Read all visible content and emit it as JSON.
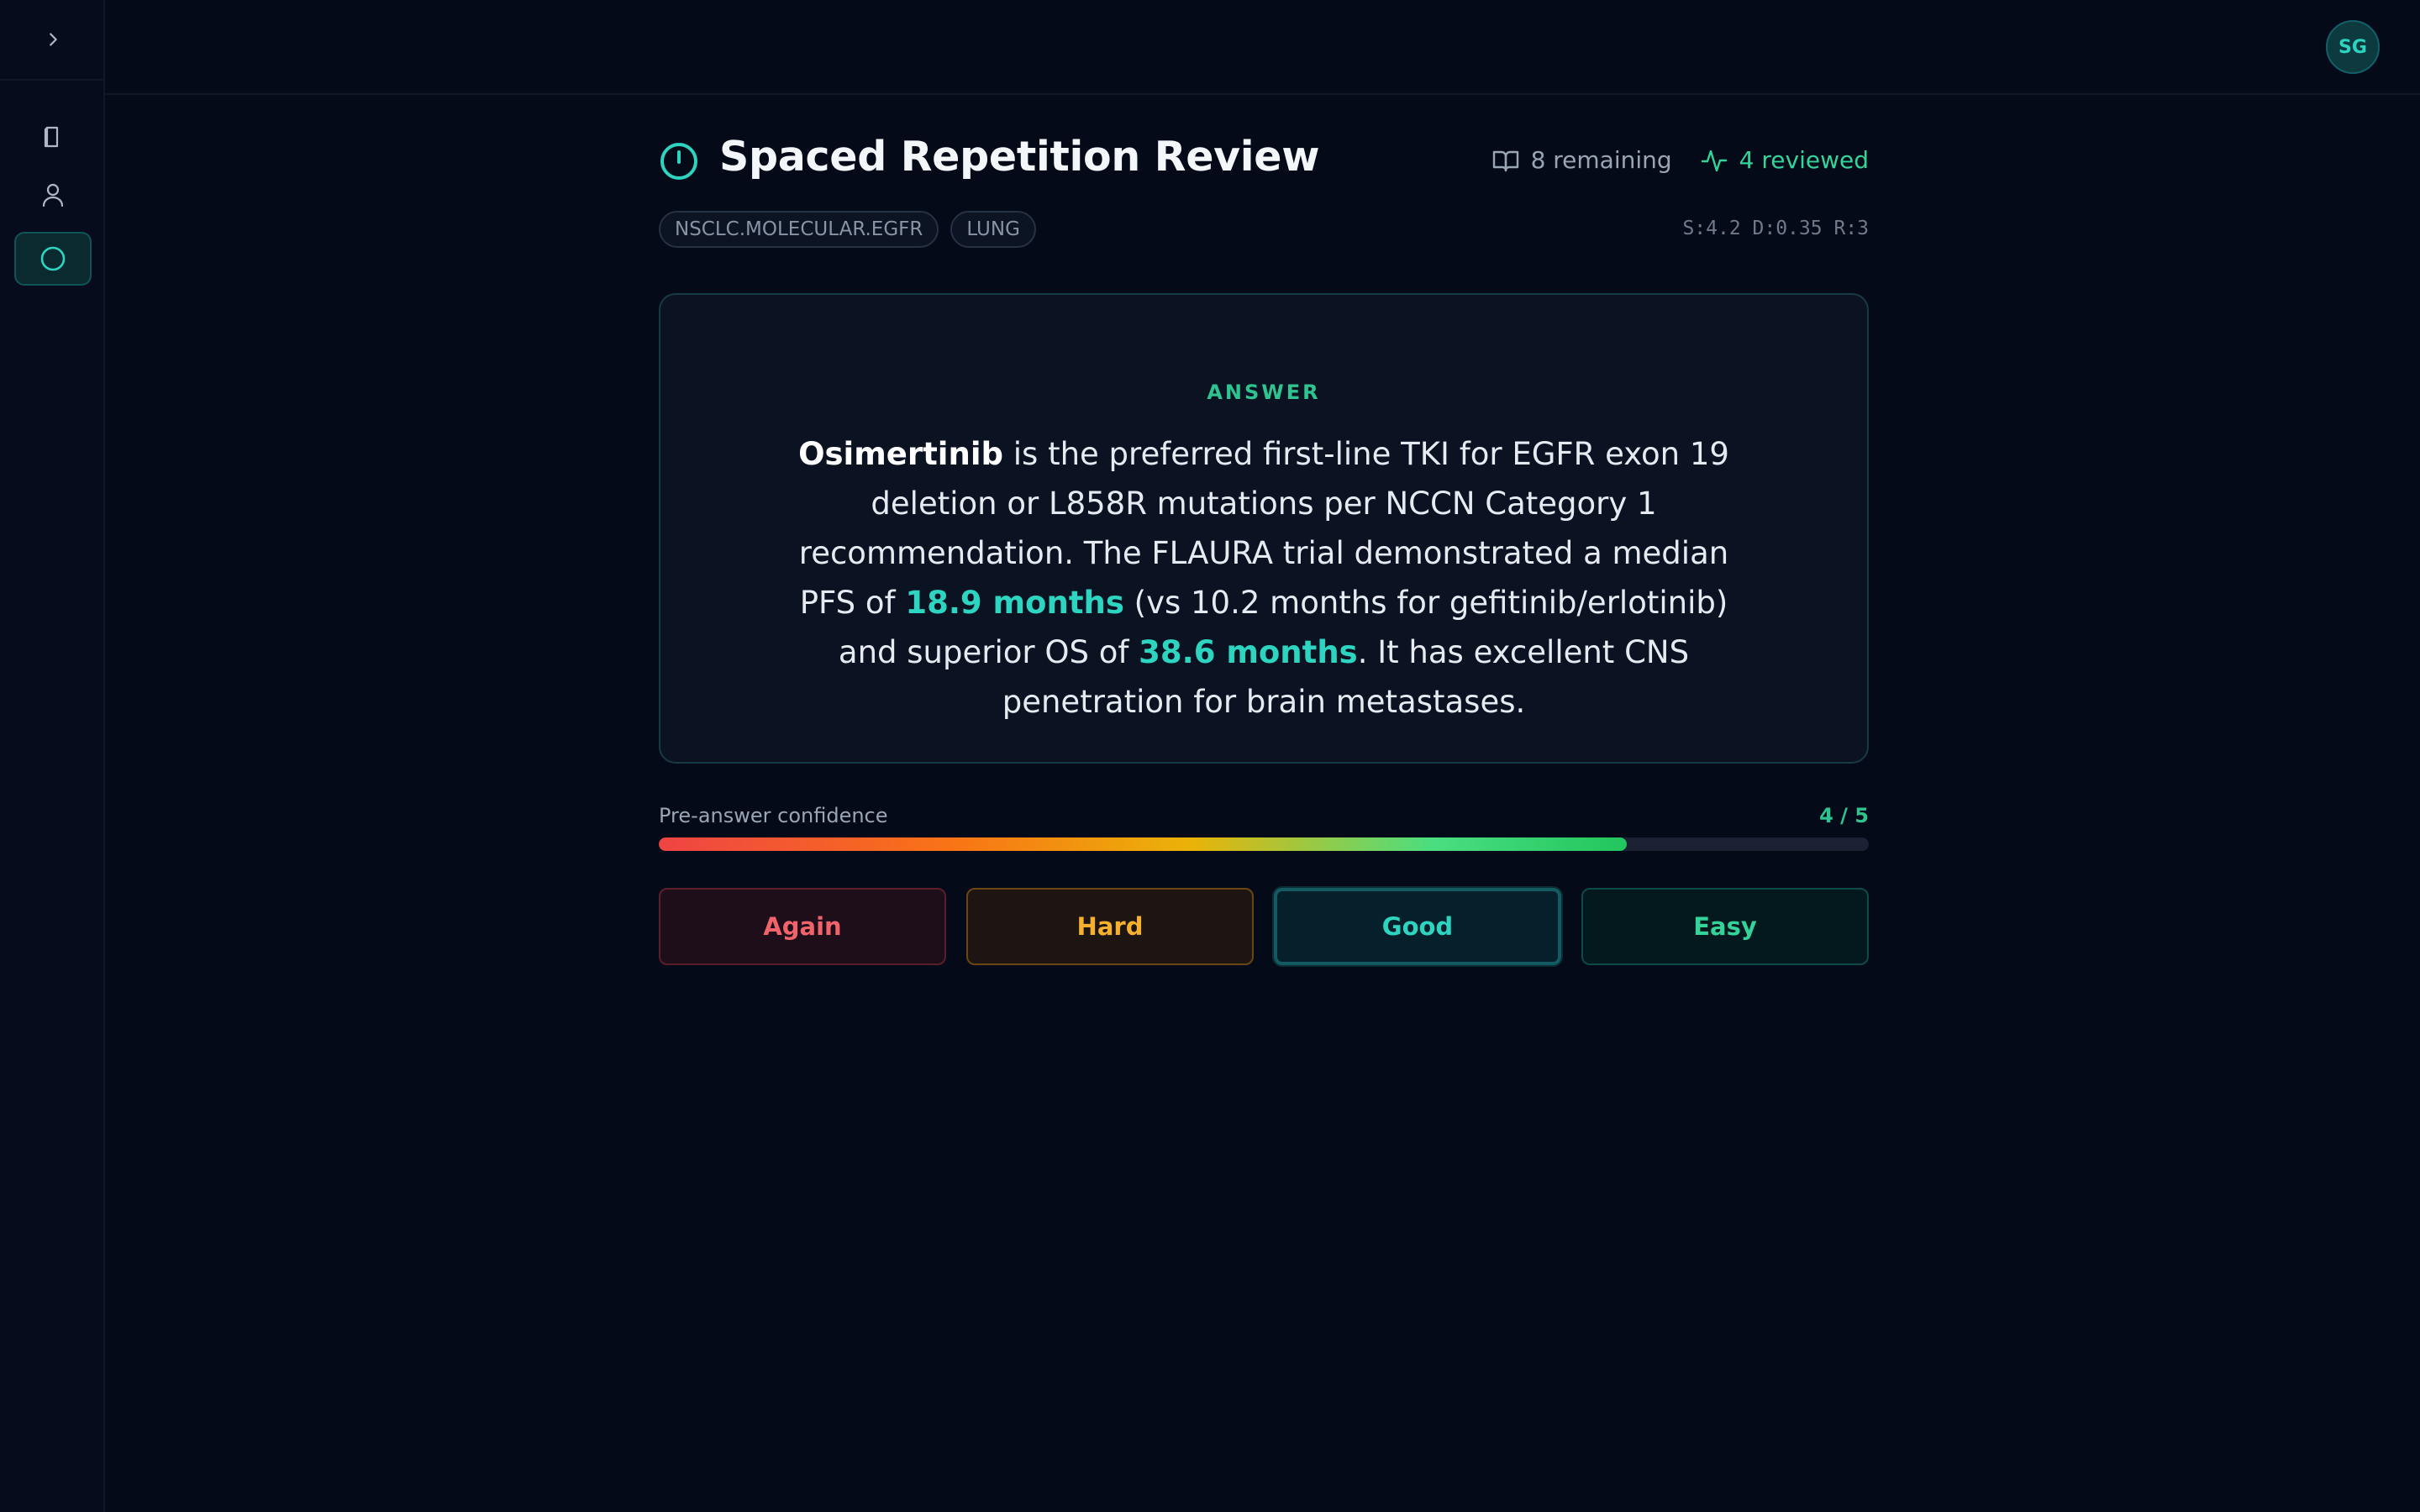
{
  "user": {
    "initials": "SG"
  },
  "header": {
    "title": "Spaced Repetition Review",
    "remaining": "8 remaining",
    "reviewed": "4 reviewed"
  },
  "card": {
    "tags": [
      "NSCLC.MOLECULAR.EGFR",
      "LUNG"
    ],
    "srs_params": "S:4.2 D:0.35 R:3",
    "answer_label": "ANSWER",
    "answer": {
      "drug": "Osimertinib",
      "text1": " is the preferred first-line TKI for EGFR exon 19 deletion or L858R mutations per NCCN Category 1 recommendation. The FLAURA trial demonstrated a median PFS of ",
      "pfs": "18.9 months",
      "text2": " (vs 10.2 months for gefitinib/erlotinib) and superior OS of ",
      "os": "38.6 months",
      "text3": ". It has excellent CNS penetration for brain metastases."
    }
  },
  "confidence": {
    "label": "Pre-answer confidence",
    "value_text": "4 / 5",
    "level": 0.8
  },
  "ratings": {
    "again": "Again",
    "hard": "Hard",
    "good": "Good",
    "easy": "Easy"
  },
  "colors": {
    "accent": "#2dd4bf",
    "success": "#34d399",
    "again": "#f0636b",
    "hard": "#f5b02d"
  }
}
